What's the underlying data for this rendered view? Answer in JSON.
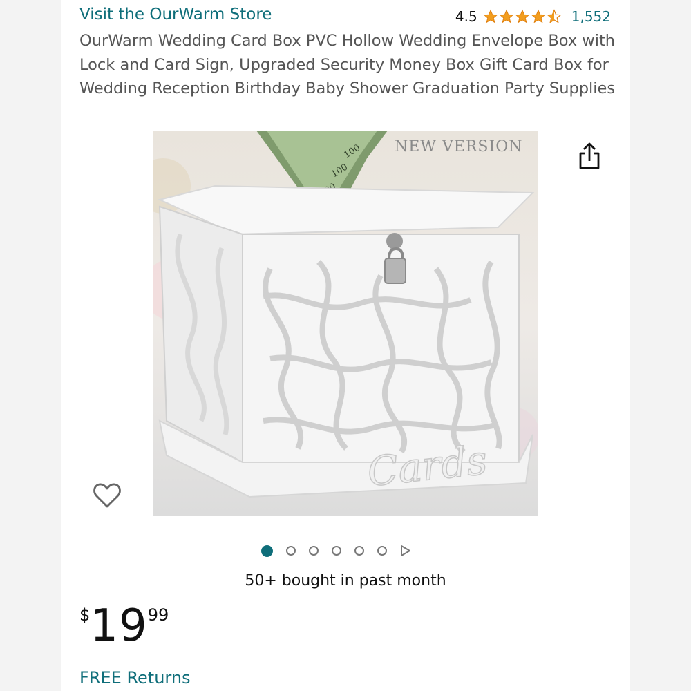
{
  "store": {
    "link_text": "Visit the OurWarm Store"
  },
  "rating": {
    "score": "4.5",
    "stars_value": 4.5,
    "stars_max": 5,
    "count": "1,552",
    "star_color": "#f29d1e"
  },
  "product": {
    "title": "OurWarm Wedding Card Box PVC Hollow Wedding Envelope Box with Lock and Card Sign, Upgraded Security Money Box Gift Card Box for Wedding Reception Birthday Baby Shower Graduation Party Supplies",
    "image_overlay_text": "NEW VERSION",
    "image_sign_text": "Cards"
  },
  "icons": {
    "share": "share-icon",
    "wishlist": "heart-icon",
    "next": "play-arrow-icon"
  },
  "carousel": {
    "count": 6,
    "active_index": 0
  },
  "social_proof": {
    "text": "50+ bought in past month"
  },
  "price": {
    "currency": "$",
    "whole": "19",
    "fraction": "99"
  },
  "returns": {
    "text": "FREE Returns"
  },
  "colors": {
    "link": "#0f6e7a",
    "dot_active": "#0f6e7a"
  }
}
